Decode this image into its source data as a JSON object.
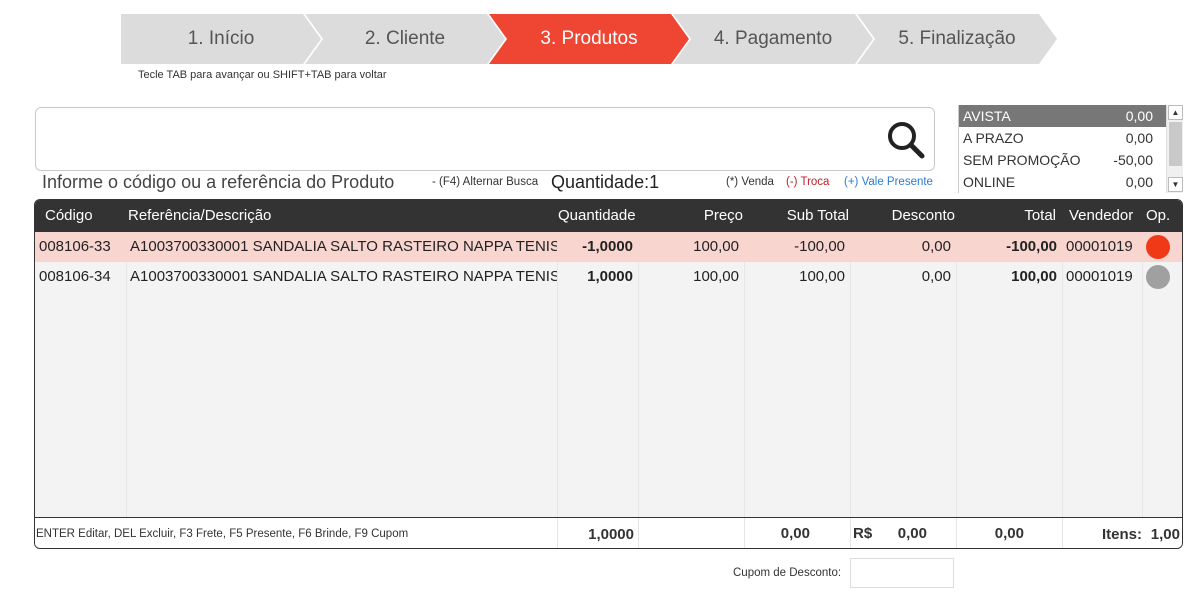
{
  "wizard": {
    "steps": [
      {
        "label": "1. Início"
      },
      {
        "label": "2. Cliente"
      },
      {
        "label": "3. Produtos"
      },
      {
        "label": "4. Pagamento"
      },
      {
        "label": "5. Finalização"
      }
    ],
    "active_step": 3,
    "hint": "Tecle TAB para avançar ou SHIFT+TAB para voltar"
  },
  "search": {
    "value": "",
    "prompt": "Informe o código ou a referência do Produto",
    "alt_search": "- (F4) Alternar Busca",
    "quantity_label": "Quantidade:",
    "quantity_value": "1"
  },
  "legend": {
    "venda": "(*) Venda",
    "troca": "(-) Troca",
    "vale": "(+) Vale Presente"
  },
  "price_tables": [
    {
      "name": "AVISTA",
      "value": "0,00",
      "selected": true
    },
    {
      "name": "A PRAZO",
      "value": "0,00"
    },
    {
      "name": "SEM PROMOÇÃO",
      "value": "-50,00"
    },
    {
      "name": "ONLINE",
      "value": "0,00"
    }
  ],
  "grid": {
    "headers": {
      "codigo": "Código",
      "descricao": "Referência/Descrição",
      "quantidade": "Quantidade",
      "preco": "Preço",
      "subtotal": "Sub Total",
      "desconto": "Desconto",
      "total": "Total",
      "vendedor": "Vendedor",
      "op": "Op."
    },
    "rows": [
      {
        "codigo": "008106-33",
        "descricao": "A1003700330001 SANDALIA SALTO RASTEIRO NAPPA TENIS",
        "quantidade": "-1,0000",
        "preco": "100,00",
        "subtotal": "-100,00",
        "desconto": "0,00",
        "total": "-100,00",
        "vendedor": "00001019",
        "op_color": "#f03a17",
        "troca": true
      },
      {
        "codigo": "008106-34",
        "descricao": "A1003700330001 SANDALIA SALTO RASTEIRO NAPPA TENIS",
        "quantidade": "1,0000",
        "preco": "100,00",
        "subtotal": "100,00",
        "desconto": "0,00",
        "total": "100,00",
        "vendedor": "00001019",
        "op_color": "#a0a0a0",
        "troca": false
      }
    ],
    "footer": {
      "shortcuts": "ENTER Editar, DEL Excluir, F3 Frete, F5 Presente, F6 Brinde, F9 Cupom",
      "quantidade_total": "1,0000",
      "subtotal_total": "0,00",
      "currency": "R$",
      "desconto_total": "0,00",
      "total": "0,00",
      "itens_label": "Itens:",
      "itens_value": "1,00"
    }
  },
  "coupon": {
    "label": "Cupom de Desconto:",
    "value": ""
  }
}
